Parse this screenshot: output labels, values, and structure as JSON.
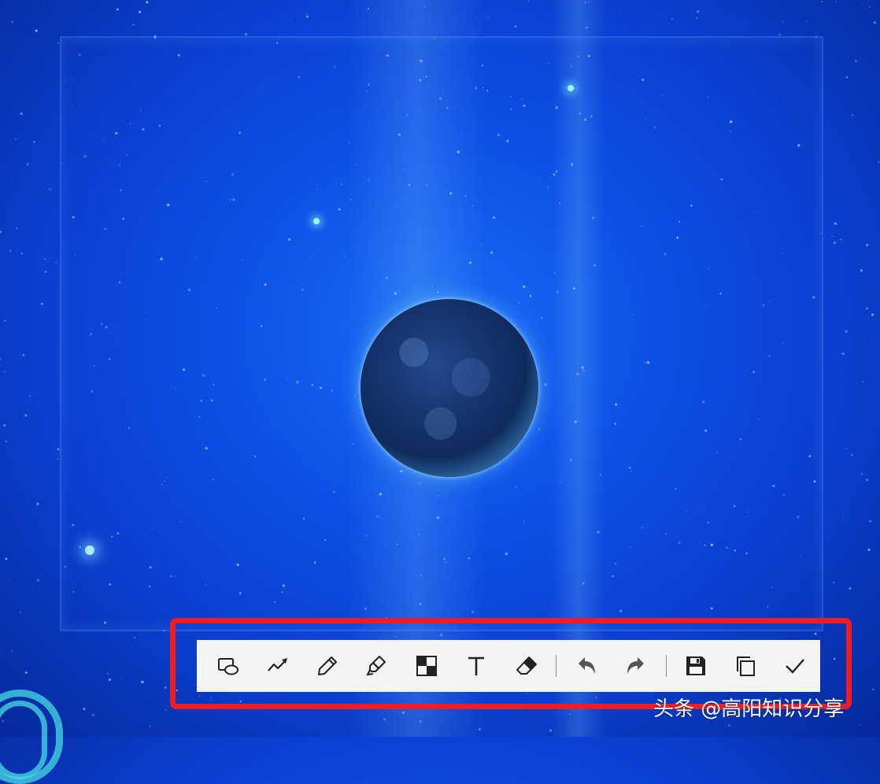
{
  "background": {
    "description_color": "#0d4fe6"
  },
  "highlight": {
    "color": "#ee1c25"
  },
  "toolbar": {
    "tools": [
      {
        "icon": "shape-icon"
      },
      {
        "icon": "arrow-line-icon"
      },
      {
        "icon": "pencil-icon"
      },
      {
        "icon": "highlighter-icon"
      },
      {
        "icon": "mosaic-icon"
      },
      {
        "icon": "text-icon"
      },
      {
        "icon": "eraser-icon"
      },
      {
        "icon": "undo-icon"
      },
      {
        "icon": "redo-icon"
      },
      {
        "icon": "save-icon"
      },
      {
        "icon": "copy-icon"
      },
      {
        "icon": "confirm-check-icon"
      }
    ]
  },
  "watermark": {
    "text": "头条 @高阳知识分享"
  }
}
